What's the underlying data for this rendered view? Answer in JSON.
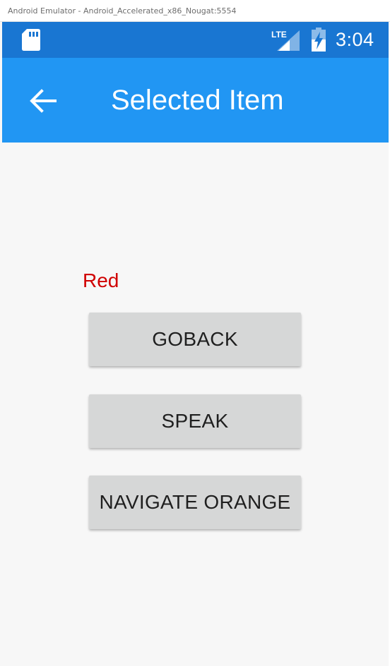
{
  "window": {
    "title": "Android Emulator - Android_Accelerated_x86_Nougat:5554"
  },
  "statusbar": {
    "icons": [
      "sd-card-icon",
      "lte-signal-icon",
      "battery-charging-icon"
    ],
    "network_label": "LTE",
    "time": "3:04",
    "color": "#1976d2"
  },
  "appbar": {
    "title": "Selected Item",
    "back_icon": "arrow-back-icon",
    "color": "#2196f3"
  },
  "content": {
    "item_label": "Red",
    "item_label_color": "#d00000",
    "buttons": [
      {
        "label": "GOBACK"
      },
      {
        "label": "SPEAK"
      },
      {
        "label": "NAVIGATE ORANGE"
      }
    ]
  }
}
